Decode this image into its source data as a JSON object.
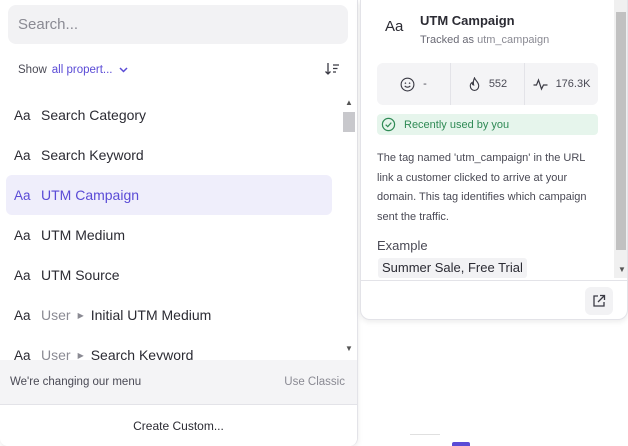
{
  "search": {
    "placeholder": "Search..."
  },
  "filter": {
    "show_label": "Show",
    "value": "all propert..."
  },
  "properties": [
    {
      "label": "Search Category",
      "prefix": ""
    },
    {
      "label": "Search Keyword",
      "prefix": ""
    },
    {
      "label": "UTM Campaign",
      "prefix": "",
      "selected": true
    },
    {
      "label": "UTM Medium",
      "prefix": ""
    },
    {
      "label": "UTM Source",
      "prefix": ""
    },
    {
      "label": "Initial UTM Medium",
      "prefix": "User"
    },
    {
      "label": "Search Keyword",
      "prefix": "User"
    }
  ],
  "type_glyph": "Aa",
  "footer": {
    "message": "We're changing our menu",
    "use_classic": "Use Classic",
    "create_custom": "Create Custom..."
  },
  "detail": {
    "title": "UTM Campaign",
    "tracked_prefix": "Tracked as",
    "tracked_code": "utm_campaign",
    "stats": {
      "emoji": "-",
      "popularity": "552",
      "activity": "176.3K"
    },
    "recent": "Recently used by you",
    "description": "The tag named 'utm_campaign' in the URL link a customer clicked to arrive at your domain. This tag identifies which campaign sent the traffic.",
    "example_heading": "Example",
    "example_value": "Summer Sale, Free Trial"
  },
  "colors": {
    "accent": "#5a4bd6",
    "selected_bg": "#efeefb",
    "success": "#2f8a55",
    "success_bg": "#e6f5ec"
  },
  "icons": [
    "sort-icon",
    "chevron-down-icon",
    "smiley-icon",
    "flame-icon",
    "activity-icon",
    "clock-check-icon",
    "external-link-icon"
  ]
}
